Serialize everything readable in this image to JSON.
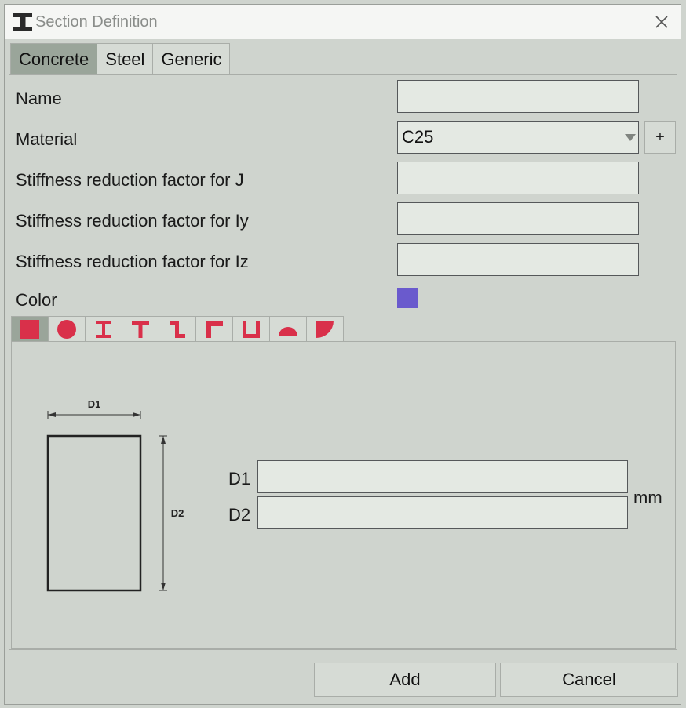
{
  "window": {
    "title": "Section Definition"
  },
  "tabs": [
    {
      "label": "Concrete",
      "active": true
    },
    {
      "label": "Steel",
      "active": false
    },
    {
      "label": "Generic",
      "active": false
    }
  ],
  "form": {
    "name_label": "Name",
    "name_value": "",
    "material_label": "Material",
    "material_value": "C25",
    "add_material_label": "+",
    "j_label": "Stiffness reduction factor for J",
    "j_value": "",
    "iy_label": "Stiffness reduction factor for Iy",
    "iy_value": "",
    "iz_label": "Stiffness reduction factor for Iz",
    "iz_value": "",
    "color_label": "Color",
    "color_value": "#6a5acd"
  },
  "shapes": [
    {
      "icon": "rectangle-section-icon",
      "active": true
    },
    {
      "icon": "circle-section-icon",
      "active": false
    },
    {
      "icon": "i-section-icon",
      "active": false
    },
    {
      "icon": "t-section-icon",
      "active": false
    },
    {
      "icon": "z-section-icon",
      "active": false
    },
    {
      "icon": "l-section-icon",
      "active": false
    },
    {
      "icon": "u-section-icon",
      "active": false
    },
    {
      "icon": "semicircle-section-icon",
      "active": false
    },
    {
      "icon": "quarter-circle-section-icon",
      "active": false
    }
  ],
  "dimensions": {
    "d1_label": "D1",
    "d1_value": "",
    "d2_label": "D2",
    "d2_value": "",
    "unit": "mm",
    "diagram_d1": "D1",
    "diagram_d2": "D2"
  },
  "buttons": {
    "add": "Add",
    "cancel": "Cancel"
  },
  "colors": {
    "shape_icon": "#d9304a",
    "active_tab": "#9aa59a"
  }
}
